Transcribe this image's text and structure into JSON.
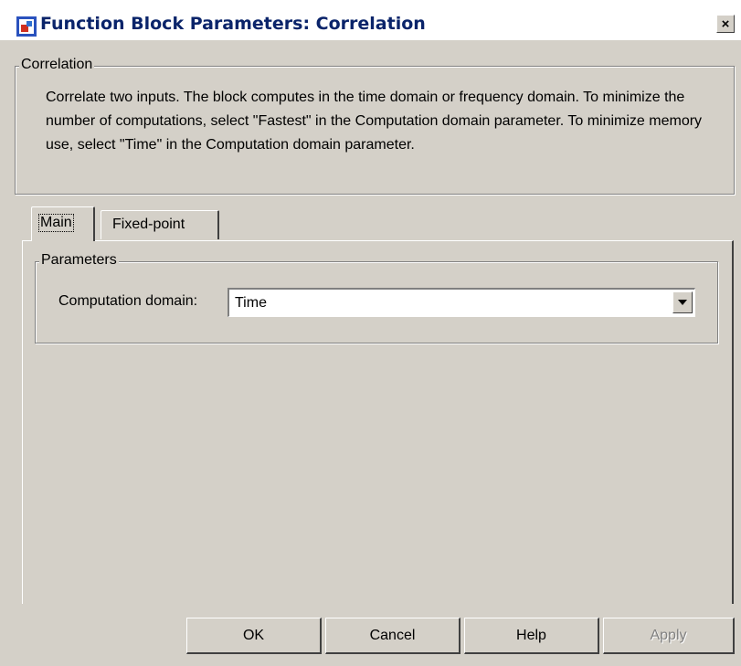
{
  "window": {
    "title": "Function Block Parameters: Correlation",
    "close_glyph": "×"
  },
  "description_group": {
    "legend": "Correlation",
    "text": "Correlate two inputs. The block computes in the time domain or frequency domain. To minimize the number of computations, select \"Fastest\" in the Computation domain parameter. To minimize memory use, select \"Time\" in the Computation domain parameter."
  },
  "tabs": [
    {
      "label": "Main",
      "selected": true
    },
    {
      "label": "Fixed-point",
      "selected": false
    }
  ],
  "parameters_group": {
    "legend": "Parameters",
    "computation_domain": {
      "label": "Computation domain:",
      "value": "Time"
    }
  },
  "buttons": {
    "ok": "OK",
    "cancel": "Cancel",
    "help": "Help",
    "apply": "Apply"
  },
  "colors": {
    "dialog_bg": "#d4d0c8",
    "title_text": "#0a246a",
    "disabled_text": "#808080"
  },
  "icons": {
    "app": "simulink-block-icon",
    "close": "close-icon",
    "dropdown": "chevron-down-icon"
  }
}
